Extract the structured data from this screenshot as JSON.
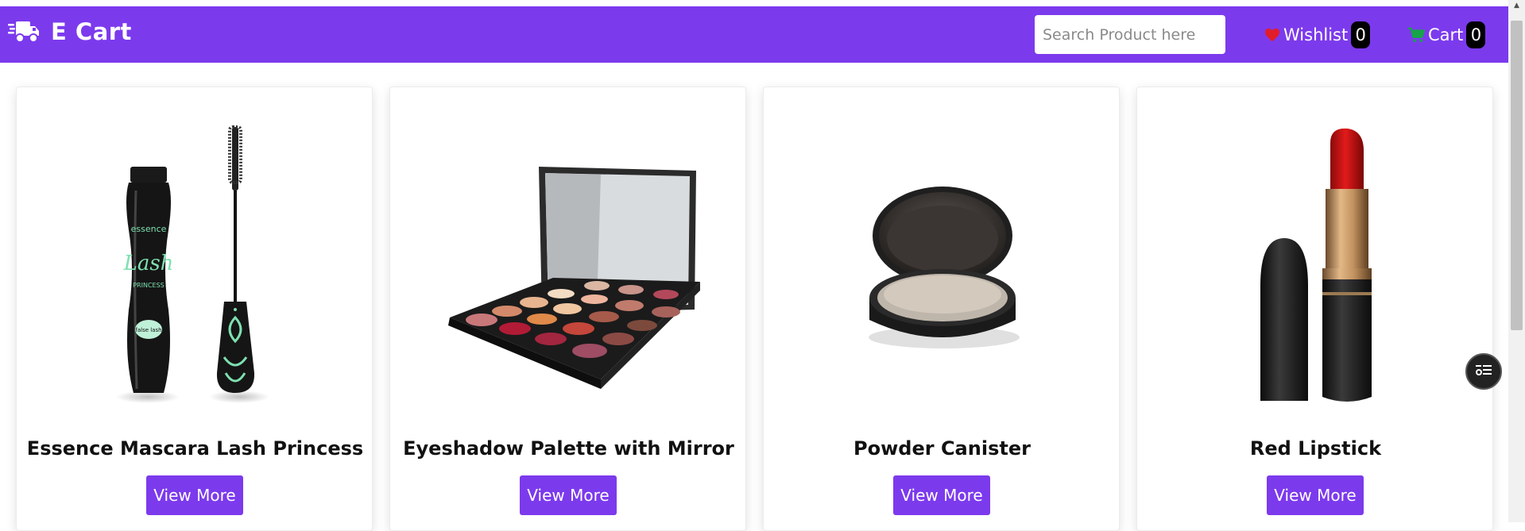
{
  "navbar": {
    "brand_title": "E Cart",
    "brand_icon": "truck-fast-icon",
    "search": {
      "placeholder": "Search Product here",
      "value": ""
    },
    "wishlist": {
      "label": "Wishlist",
      "count": "0",
      "icon": "heart-icon",
      "icon_color": "#e11d2a"
    },
    "cart": {
      "label": "Cart",
      "count": "0",
      "icon": "cart-icon",
      "icon_color": "#16a34a"
    }
  },
  "colors": {
    "primary": "#7c3aed",
    "badge": "#000000",
    "text": "#111111"
  },
  "products": [
    {
      "title": "Essence Mascara Lash Princess",
      "button": "View More",
      "image": "mascara"
    },
    {
      "title": "Eyeshadow Palette with Mirror",
      "button": "View More",
      "image": "eyeshadow-palette"
    },
    {
      "title": "Powder Canister",
      "button": "View More",
      "image": "powder-canister"
    },
    {
      "title": "Red Lipstick",
      "button": "View More",
      "image": "red-lipstick"
    }
  ],
  "floating_action": {
    "icon": "filter-list-icon"
  }
}
